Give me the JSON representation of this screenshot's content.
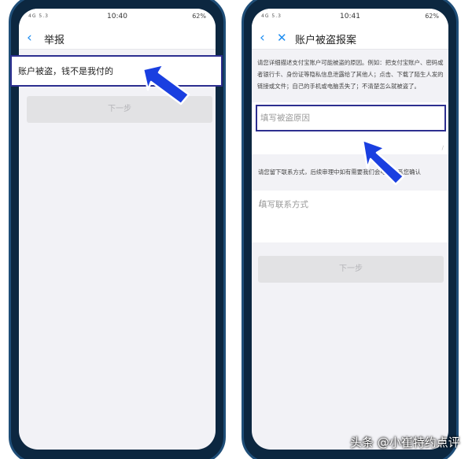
{
  "left_screen": {
    "status": {
      "time": "10:40",
      "battery": "62%",
      "carrier": "4G 5.3"
    },
    "header": {
      "title": "举报"
    },
    "option": {
      "label": "账户被盗，钱不是我付的"
    },
    "next_button": {
      "label": "下一步"
    }
  },
  "right_screen": {
    "status": {
      "time": "10:41",
      "battery": "62%",
      "carrier": "4G 5.3"
    },
    "header": {
      "title": "账户被盗报案"
    },
    "description": "请您详细描述支付宝账户可能被盗的原因。例如：把支付宝账户、密码或者银行卡、身份证等隐私信息泄露给了其他人；点击、下载了陌生人发的链接或文件；自己的手机或电脑丢失了；不清楚怎么就被盗了。",
    "reason_field": {
      "placeholder": "填写被盗原因"
    },
    "contact_description": "请您留下联系方式，后续审理中如有需要我们会电话联系您确认",
    "contact_field": {
      "placeholder": "填写联系方式"
    },
    "next_button": {
      "label": "下一步"
    }
  },
  "watermark": "头条 @小崔特约点评",
  "colors": {
    "accent": "#1d8cf0",
    "highlight_border": "#2d2f90",
    "arrow": "#1a3fe0"
  }
}
